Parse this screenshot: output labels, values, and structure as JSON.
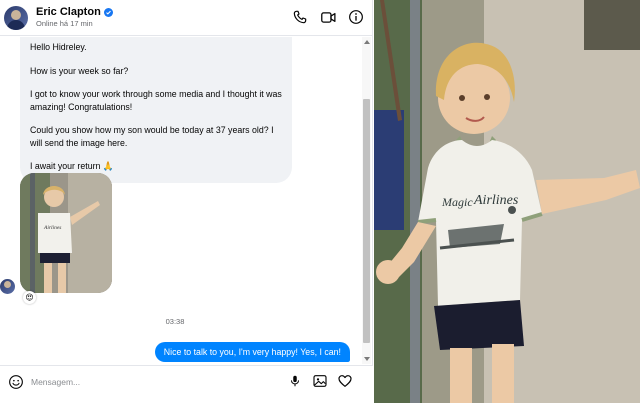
{
  "header": {
    "name": "Eric Clapton",
    "status": "Online há 17 min",
    "icons": [
      "phone-icon",
      "video-call-icon",
      "info-icon",
      "verified-badge-icon"
    ]
  },
  "messages": {
    "incoming": [
      "Hello Hidreley.",
      "How is your week so far?",
      "I got to know your work through some media and I thought it was amazing! Congratulations!",
      "Could you show how my son would be today at 37 years old? I will send the image here.",
      "I await your return 🙏"
    ],
    "image_reaction": "😍",
    "timestamp": "03:38",
    "outgoing": "Nice to talk to you, I'm very happy! Yes, I can!",
    "image_shirt_text": "Airlines"
  },
  "composer": {
    "placeholder": "Mensagem...",
    "icons": [
      "emoji-icon",
      "microphone-icon",
      "image-icon",
      "heart-icon"
    ]
  },
  "photo": {
    "shirt_text_line1": "Magic",
    "shirt_text_line2": "Airlines"
  },
  "colors": {
    "accent_blue": "#0084ff",
    "incoming_bubble": "#f0f2f5",
    "verified_blue": "#1877f2"
  }
}
